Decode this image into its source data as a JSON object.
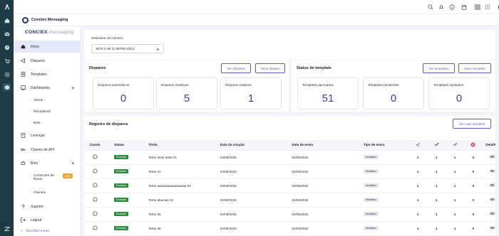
{
  "app": {
    "title": "Conciex Messaging",
    "brand_main": "CONCIEX",
    "brand_sub": "messaging"
  },
  "rail": {
    "icons": [
      "logo-icon",
      "home-icon",
      "mail-icon",
      "clock-icon",
      "cart-icon",
      "gear-icon",
      "box-icon",
      "zendesk-icon"
    ]
  },
  "topbar": {
    "icons": [
      "search-icon",
      "bell-icon",
      "info-icon",
      "calendar-icon",
      "grid-icon",
      "apps-icon"
    ]
  },
  "sidebar": {
    "items": [
      {
        "label": "Início",
        "icon": "home-icon",
        "active": true
      },
      {
        "label": "Disparos",
        "icon": "megaphone-icon"
      },
      {
        "label": "Templates",
        "icon": "template-icon"
      },
      {
        "label": "Dashboards",
        "icon": "dashboard-icon",
        "expanded": true
      },
      {
        "label": "Licenças",
        "icon": "license-icon"
      },
      {
        "label": "Chaves de API",
        "icon": "key-icon"
      },
      {
        "label": "Bots",
        "icon": "bot-icon",
        "expanded": true
      },
      {
        "label": "Suporte",
        "icon": "help-icon"
      },
      {
        "label": "Logout",
        "icon": "logout-icon"
      }
    ],
    "dash_sub": [
      "Ativos",
      "Receptivos",
      "Bots"
    ],
    "bots_sub": [
      "Construtor de",
      "fluxos",
      "Clientes"
    ],
    "beta": "Beta",
    "collapse": "Encolher menu"
  },
  "number": {
    "label": "Selecione um número",
    "value": "BCR (+55 11 98765-4321)"
  },
  "disparos": {
    "title": "Disparos",
    "btn_view": "Ver disparos",
    "btn_new": "Novo disparo",
    "stats": [
      {
        "label": "Disparos automáticos",
        "value": "0"
      },
      {
        "label": "Disparos massivos",
        "value": "5"
      },
      {
        "label": "Disparos unitários",
        "value": "1"
      }
    ]
  },
  "templates": {
    "title": "Status de template",
    "btn_view": "Ver templates",
    "btn_new": "Novo template",
    "stats": [
      {
        "label": "Templates aprovados",
        "value": "51"
      },
      {
        "label": "Templates pendentes",
        "value": "0"
      },
      {
        "label": "Templates rejeitados",
        "value": "0"
      }
    ]
  },
  "registro": {
    "title": "Registro de disparos",
    "btn_more": "Ver mais detalhes",
    "headers": [
      "Canais",
      "Status",
      "Título",
      "Data da criação",
      "Data de envio",
      "Tipo de envio",
      "",
      "",
      "",
      "",
      "Detalhes"
    ],
    "rows": [
      {
        "status": "Enviada",
        "title": "Teste teste teste 01",
        "created": "04/09/2025",
        "sent": "04/09/2025",
        "type": "Imediato",
        "c1": "1",
        "c2": "1",
        "c3": "1",
        "c4": "0"
      },
      {
        "status": "Enviada",
        "title": "Teste 02",
        "created": "04/09/2025",
        "sent": "04/09/2025",
        "type": "Imediato",
        "c1": "1",
        "c2": "1",
        "c3": "1",
        "c4": "0"
      },
      {
        "status": "Enviada",
        "title": "Teste aaaaaaaaaaaaaaaa 03",
        "created": "03/09/2025",
        "sent": "03/09/2025",
        "type": "Imediato",
        "c1": "1",
        "c2": "1",
        "c3": "1",
        "c4": "0"
      },
      {
        "status": "Enviada",
        "title": "Teste abacate 04",
        "created": "02/09/2025",
        "sent": "04/09/2025",
        "type": "Imediato",
        "c1": "1",
        "c2": "1",
        "c3": "1",
        "c4": "0"
      },
      {
        "status": "Enviada",
        "title": "Teste 05",
        "created": "02/09/2025",
        "sent": "04/09/2025",
        "type": "Imediato",
        "c1": "1",
        "c2": "1",
        "c3": "1",
        "c4": "0"
      },
      {
        "status": "Enviada",
        "title": "Teste 06",
        "created": "02/09/2025",
        "sent": "04/09/2025",
        "type": "Imediato",
        "c1": "1",
        "c2": "1",
        "c3": "1",
        "c4": "0"
      }
    ]
  },
  "colors": {
    "accent": "#5a5fc0",
    "value": "#3b3fa8",
    "rail": "#1e3a45",
    "ok": "#2e8b3e",
    "reject": "#d9363e"
  }
}
